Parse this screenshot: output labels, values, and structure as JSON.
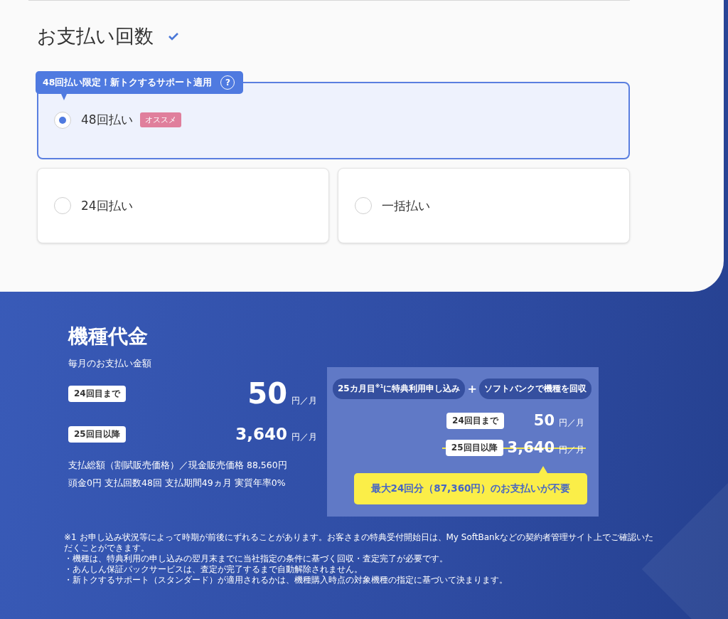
{
  "payment_count": {
    "title": "お支払い回数",
    "options": [
      {
        "label": "48回払い",
        "selected": true,
        "banner": "48回払い限定！新トクするサポート適用",
        "help": "?",
        "badge": "オススメ"
      },
      {
        "label": "24回払い",
        "selected": false
      },
      {
        "label": "一括払い",
        "selected": false
      }
    ]
  },
  "device_price": {
    "title": "機種代金",
    "subtitle": "毎月のお支払い金額",
    "rows": [
      {
        "tag": "24回目まで",
        "amount": "50",
        "unit": "円／月"
      },
      {
        "tag": "25回目以降",
        "amount": "3,640",
        "unit": "円／月"
      }
    ],
    "details": [
      "支払総額（割賦販売価格）／現金販売価格 88,560円",
      "頭金0円 支払回数48回 支払期間49ヵ月 実質年率0%"
    ]
  },
  "benefit": {
    "steps": [
      "25カ月目$^{※1}$に特典利用申し込み",
      "ソフトバンクで機種を回収"
    ],
    "joiner": "+",
    "rows": [
      {
        "tag": "24回目まで",
        "amount": "50",
        "unit": "円／月",
        "struck": false
      },
      {
        "tag": "25回目以降",
        "amount": "3,640",
        "unit": "円／月",
        "struck": true
      }
    ],
    "callout": "最大24回分（87,360円）のお支払いが不要"
  },
  "notes": [
    "※1 お申し込み状況等によって時期が前後にずれることがあります。お客さまの特典受付開始日は、My SoftBankなどの契約者管理サイト上でご確認いただくことができます。",
    "・機種は、特典利用の申し込みの翌月末までに当社指定の条件に基づく回収・査定完了が必要です。",
    "・あんしん保証パックサービスは、査定が完了するまで自動解除されません。",
    "・新トクするサポート（スタンダード）が適用されるかは、機種購入時点の対象機種の指定に基づいて決まります。"
  ]
}
